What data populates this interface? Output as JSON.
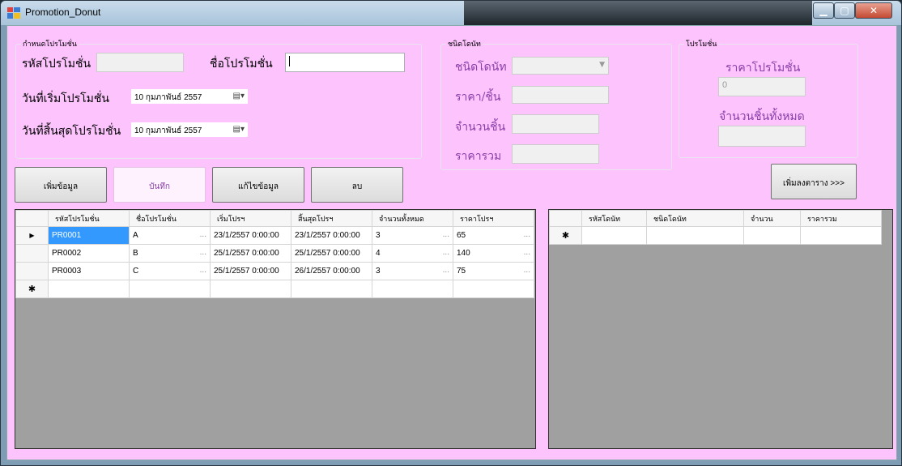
{
  "window": {
    "title": "Promotion_Donut"
  },
  "promo_group": {
    "title": "กำหนดโปรโมชั่น",
    "code_label": "รหัสโปรโมชั่น",
    "code_value": "",
    "name_label": "ชื่อโปรโมชั่น",
    "name_value": "",
    "start_label": "วันที่เริ่มโปรโมชั่น",
    "start_value": "10  กุมภาพันธ์  2557",
    "end_label": "วันที่สิ้นสุดโปรโมชั่น",
    "end_value": "10  กุมภาพันธ์  2557"
  },
  "donut_group": {
    "title": "ชนิดโดนัท",
    "type_label": "ชนิดโดนัท",
    "type_value": "",
    "price_label": "ราคา/ชิ้น",
    "price_value": "",
    "qty_label": "จำนวนชิ้น",
    "qty_value": "",
    "total_label": "ราคารวม",
    "total_value": ""
  },
  "summary_group": {
    "title": "โปรโมชั่น",
    "price_label": "ราคาโปรโมชั่น",
    "price_value": "0",
    "count_label": "จำนวนชิ้นทั้งหมด",
    "count_value": ""
  },
  "buttons": {
    "add": "เพิ่มข้อมูล",
    "save": "บันทึก",
    "edit": "แก้ไขข้อมูล",
    "delete": "ลบ",
    "add_to_table": "เพิ่มลงตาราง >>>"
  },
  "promo_table": {
    "columns": [
      "รหัสโปรโมชั่น",
      "ชื่อโปรโมชั่น",
      "เริ่มโปรฯ",
      "สิ้นสุดโปรฯ",
      "จำนวนทั้งหมด",
      "ราคาโปรฯ"
    ],
    "rows": [
      [
        "PR0001",
        "A",
        "23/1/2557 0:00:00",
        "23/1/2557 0:00:00",
        "3",
        "65"
      ],
      [
        "PR0002",
        "B",
        "25/1/2557 0:00:00",
        "25/1/2557 0:00:00",
        "4",
        "140"
      ],
      [
        "PR0003",
        "C",
        "25/1/2557 0:00:00",
        "26/1/2557 0:00:00",
        "3",
        "75"
      ]
    ]
  },
  "donut_table": {
    "columns": [
      "รหัสโดนัท",
      "ชนิดโดนัท",
      "จำนวน",
      "ราคารวม"
    ]
  },
  "glyphs": {
    "current_row": "▶",
    "new_row": "✱",
    "ellipsis": "..."
  }
}
